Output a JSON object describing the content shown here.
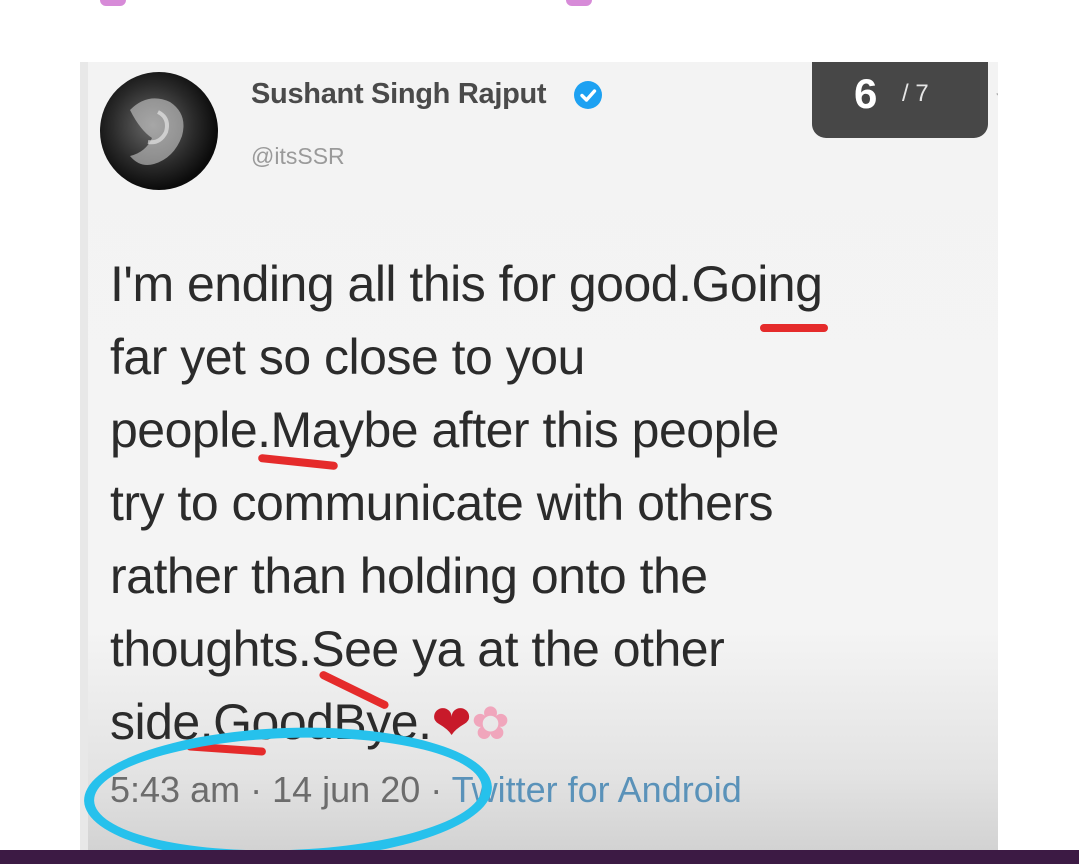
{
  "tweet": {
    "display_name": "Sushant Singh Rajput",
    "handle": "@itsSSR",
    "text_lines": [
      "I'm ending all this for good.Going",
      "far yet so close to you",
      "people.Maybe after this people",
      "try to communicate with others",
      "rather than holding onto the",
      "thoughts.See ya at the other",
      "side.GoodBye."
    ],
    "emoji_heart": "❤",
    "emoji_flower": "✿",
    "time": "5:43 am",
    "separator": "·",
    "date": "14 jun 20",
    "source": "Twitter for Android"
  },
  "counter": {
    "current": "6",
    "total": "/ 7"
  },
  "icons": {
    "verified": "verified-badge-icon",
    "chevron": "chevron-down-icon"
  },
  "colors": {
    "verified": "#1da1f2",
    "counter_bg": "#474747",
    "annotation_red": "#e52b2b",
    "annotation_circle": "#26c1ec",
    "bottom_bar": "#3c1a44",
    "top_marks": "#d78bd8"
  }
}
